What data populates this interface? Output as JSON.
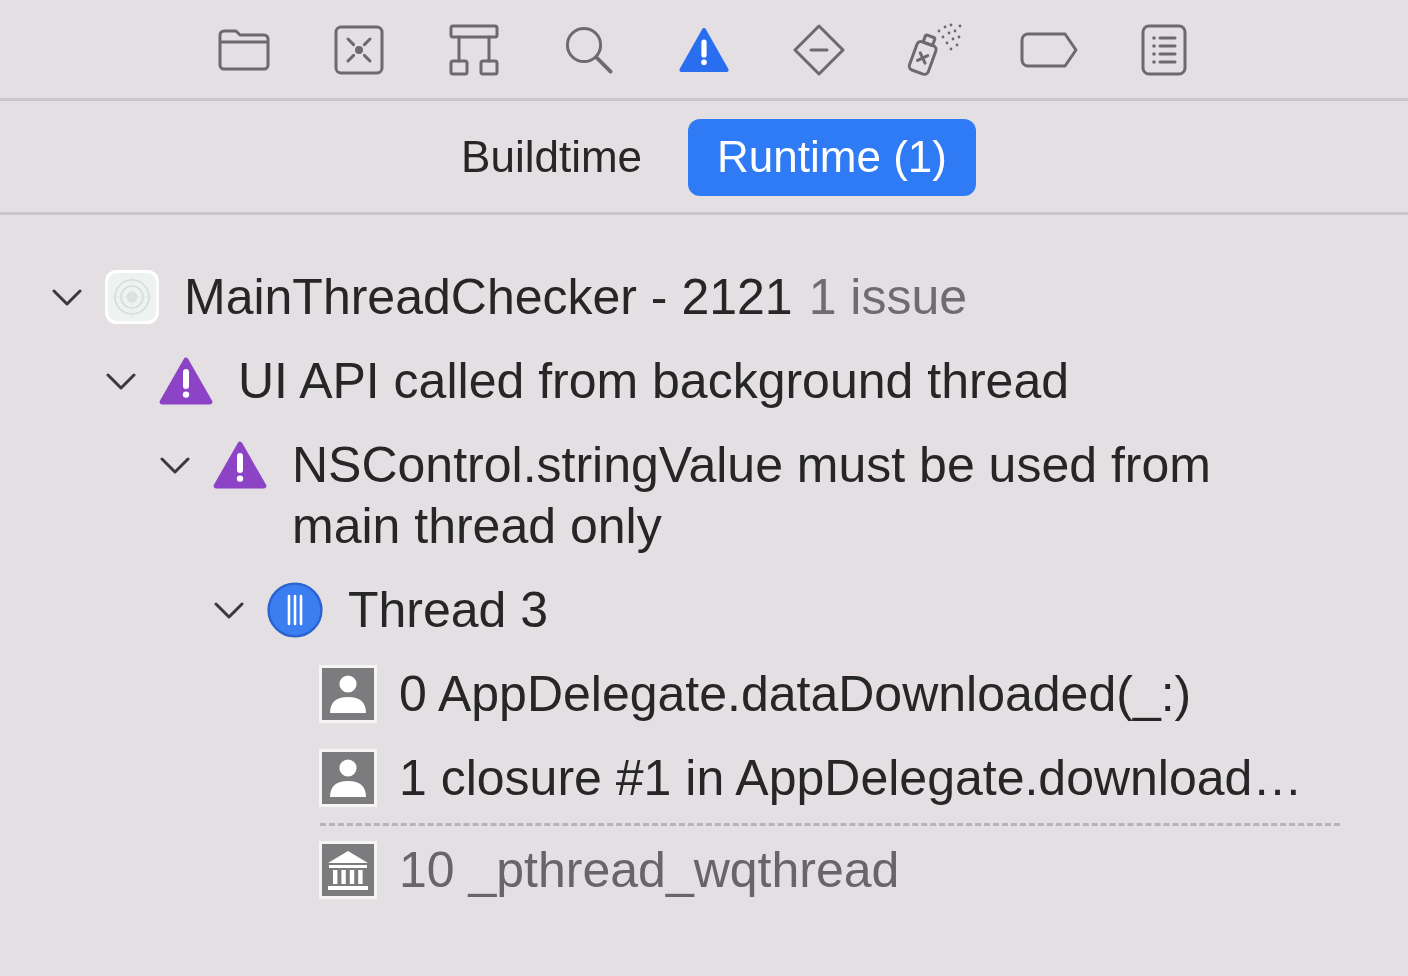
{
  "navigator_tabs": [
    {
      "kind": "folder",
      "selected": false
    },
    {
      "kind": "source_control",
      "selected": false
    },
    {
      "kind": "symbols",
      "selected": false
    },
    {
      "kind": "find",
      "selected": false
    },
    {
      "kind": "issues",
      "selected": true
    },
    {
      "kind": "tests",
      "selected": false
    },
    {
      "kind": "debug",
      "selected": false
    },
    {
      "kind": "breakpoints",
      "selected": false
    },
    {
      "kind": "reports",
      "selected": false
    }
  ],
  "scope_tabs": [
    {
      "label": "Buildtime",
      "selected": false
    },
    {
      "label": "Runtime (1)",
      "selected": true
    }
  ],
  "issues": [
    {
      "kind": "target",
      "title": "MainThreadChecker - 2121",
      "count": "1 issue",
      "expanded": true,
      "children": [
        {
          "kind": "warning",
          "title": "UI API called from background thread",
          "expanded": true,
          "children": [
            {
              "kind": "warning",
              "title": "NSControl.stringValue must be used from main thread only",
              "expanded": true,
              "children": [
                {
                  "kind": "thread",
                  "title": "Thread 3",
                  "expanded": true,
                  "children": [
                    {
                      "kind": "user_frame",
                      "title": "0 AppDelegate.dataDownloaded(_:)"
                    },
                    {
                      "kind": "user_frame",
                      "title": "1 closure #1 in AppDelegate.download…"
                    },
                    {
                      "kind": "elided"
                    },
                    {
                      "kind": "system_frame",
                      "title": "10 _pthread_wqthread"
                    }
                  ]
                }
              ]
            }
          ]
        }
      ]
    }
  ]
}
